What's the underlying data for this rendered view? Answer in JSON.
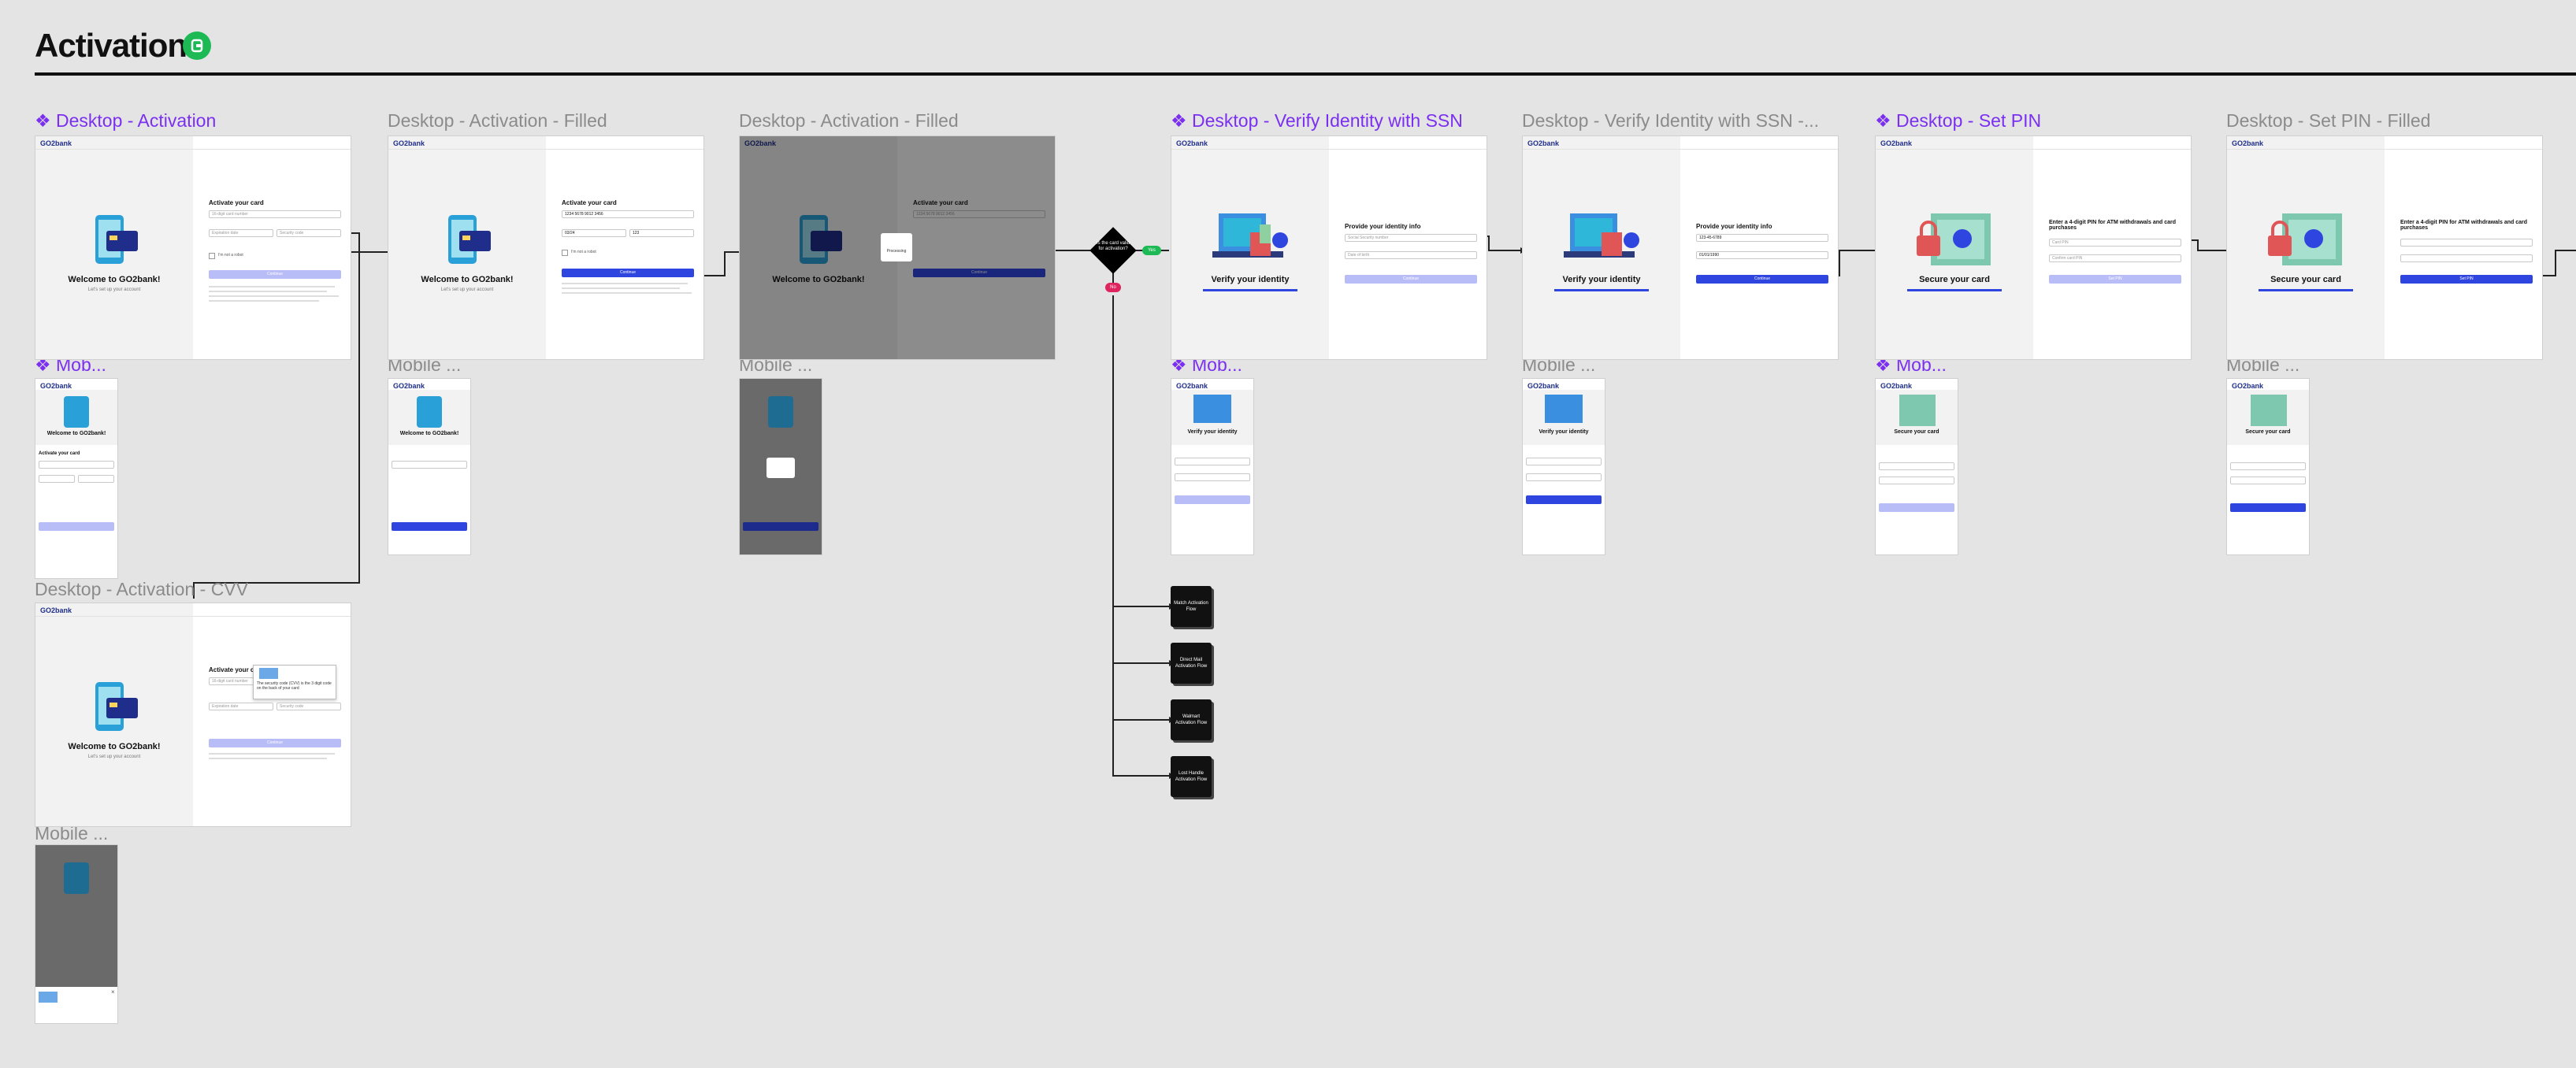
{
  "page": {
    "title": "Activation",
    "badge_icon": "figma-component-icon",
    "badge_color": "#1db954"
  },
  "frames": {
    "f1": {
      "label": "❖ Desktop - Activation",
      "component": true
    },
    "f2": {
      "label": "Desktop - Activation - Filled",
      "component": false
    },
    "f3": {
      "label": "Desktop - Activation - Filled",
      "component": false
    },
    "f4": {
      "label": "❖ Desktop - Verify Identity with SSN",
      "component": true
    },
    "f5": {
      "label": "Desktop - Verify Identity with SSN -...",
      "component": false
    },
    "f6": {
      "label": "❖ Desktop - Set PIN",
      "component": true
    },
    "f7": {
      "label": "Desktop - Set PIN - Filled",
      "component": false
    },
    "f8": {
      "label": "Desktop - Activation - CVV",
      "component": false
    }
  },
  "mobile_frames": {
    "m1": "❖ Mob...",
    "m2": "Mobile ...",
    "m3": "Mobile ...",
    "m4": "❖ Mob...",
    "m5": "Mobile ...",
    "m6": "❖ Mob...",
    "m7": "Mobile ...",
    "m8": "Mobile ..."
  },
  "screen": {
    "logo": "GO2bank",
    "welcome": "Welcome to GO2bank!",
    "welcome_sub": "Let's set up your account",
    "activate_title": "Activate your card",
    "card_placeholder": "16-digit card number",
    "exp_placeholder": "Expiration date",
    "cvv_placeholder": "Security code",
    "remember": "I'm not a robot",
    "continue": "Continue",
    "card_filled": "1234 5678 9012 3456",
    "exp_filled": "03/24",
    "cvv_filled": "123",
    "processing": "Processing",
    "verify_title": "Verify your identity",
    "provide_info": "Provide your identity info",
    "ssn_placeholder": "Social Security number",
    "dob_placeholder": "Date of birth",
    "ssn_filled": "123-45-6789",
    "dob_filled": "01/01/1990",
    "secure_title": "Secure your card",
    "pin_instruction": "Enter a 4-digit PIN for ATM withdrawals and card purchases",
    "pin_placeholder": "Card PIN",
    "pin_confirm": "Confirm card PIN",
    "set_pin": "Set PIN",
    "cvv_tooltip": "The security code (CVV) is the 3 digit code on the back of your card"
  },
  "flow": {
    "decision": "Is the card valid for activation?",
    "yes": "Yes",
    "no": "No",
    "outcomes": [
      "Match Activation Flow",
      "Direct Mail Activation Flow",
      "Walmart Activation Flow",
      "Lost Handle Activation Flow"
    ]
  },
  "colors": {
    "accent": "#2f45e0",
    "disabled": "#b9bdf7",
    "component": "#7b2ff0",
    "yes": "#1db954",
    "no": "#e0245e"
  }
}
